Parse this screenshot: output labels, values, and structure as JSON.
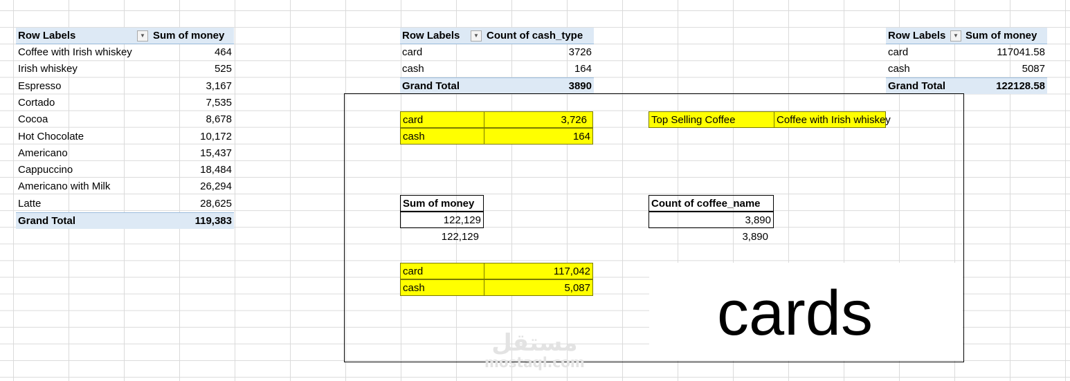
{
  "pivot_coffee": {
    "header": {
      "row_labels": "Row Labels",
      "value": "Sum of money"
    },
    "rows": [
      {
        "label": "Coffee with Irish whiskey",
        "value": "464"
      },
      {
        "label": "Irish whiskey",
        "value": "525"
      },
      {
        "label": "Espresso",
        "value": "3,167"
      },
      {
        "label": "Cortado",
        "value": "7,535"
      },
      {
        "label": "Cocoa",
        "value": "8,678"
      },
      {
        "label": "Hot Chocolate",
        "value": "10,172"
      },
      {
        "label": "Americano",
        "value": "15,437"
      },
      {
        "label": "Cappuccino",
        "value": "18,484"
      },
      {
        "label": "Americano with Milk",
        "value": "26,294"
      },
      {
        "label": "Latte",
        "value": "28,625"
      }
    ],
    "total": {
      "label": "Grand Total",
      "value": "119,383"
    },
    "filter_icon": "filter-sort-icon"
  },
  "pivot_cashtype_count": {
    "header": {
      "row_labels": "Row Labels",
      "value": "Count of cash_type"
    },
    "rows": [
      {
        "label": "card",
        "value": "3726"
      },
      {
        "label": "cash",
        "value": "164"
      }
    ],
    "total": {
      "label": "Grand Total",
      "value": "3890"
    },
    "dropdown_icon": "dropdown-arrow-icon"
  },
  "pivot_cashtype_sum": {
    "header": {
      "row_labels": "Row Labels",
      "value": "Sum of money"
    },
    "rows": [
      {
        "label": "card",
        "value": "117041.58"
      },
      {
        "label": "cash",
        "value": "5087"
      }
    ],
    "total": {
      "label": "Grand Total",
      "value": "122128.58"
    },
    "dropdown_icon": "dropdown-arrow-icon"
  },
  "dashboard": {
    "count_cards": [
      {
        "label": "card",
        "value": "3,726"
      },
      {
        "label": "cash",
        "value": "164"
      }
    ],
    "top_selling": {
      "label": "Top Selling Coffee",
      "value": "Coffee with Irish whiskey"
    },
    "sum_money": {
      "header": "Sum of money",
      "value": "122,129",
      "value_below": "122,129"
    },
    "count_coffee": {
      "header": "Count of coffee_name",
      "value": "3,890",
      "value_below": "3,890"
    },
    "money_cards": [
      {
        "label": "card",
        "value": "117,042"
      },
      {
        "label": "cash",
        "value": "5,087"
      }
    ],
    "big_text": "cards"
  },
  "watermark": {
    "arabic": "مستقل",
    "latin": "mostaql.com"
  },
  "colors": {
    "header_fill": "#dde9f5",
    "highlight": "#ffff00",
    "gridline": "#dadada"
  }
}
